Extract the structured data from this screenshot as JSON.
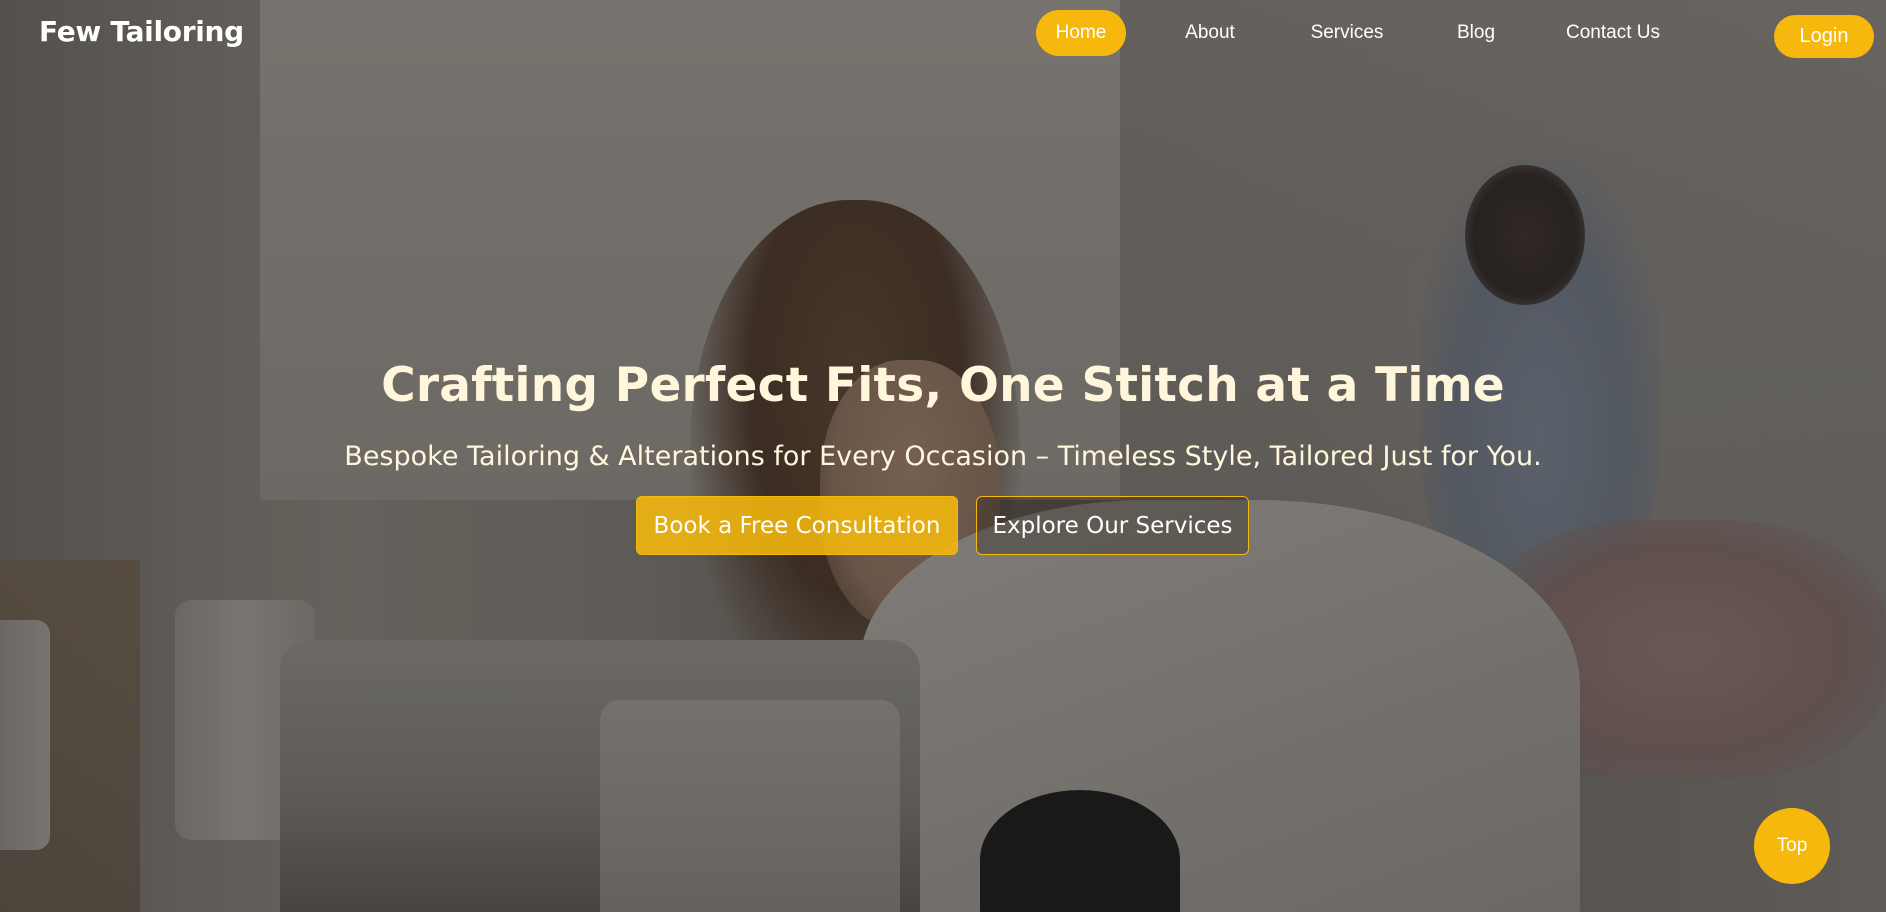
{
  "brand": {
    "name": "Few Tailoring"
  },
  "nav": {
    "items": [
      {
        "label": "Home",
        "active": true
      },
      {
        "label": "About",
        "active": false
      },
      {
        "label": "Services",
        "active": false
      },
      {
        "label": "Blog",
        "active": false
      },
      {
        "label": "Contact Us",
        "active": false
      }
    ],
    "login_label": "Login"
  },
  "hero": {
    "title": "Crafting Perfect Fits, One Stitch at a Time",
    "subtitle": "Bespoke Tailoring & Alterations for Every Occasion – Timeless Style, Tailored Just for You.",
    "primary_cta": "Book a Free Consultation",
    "secondary_cta": "Explore Our Services"
  },
  "back_to_top": {
    "label": "Top"
  },
  "colors": {
    "accent": "#f6b80d",
    "hero_text": "#fff6dc",
    "nav_text": "#ffffff"
  }
}
